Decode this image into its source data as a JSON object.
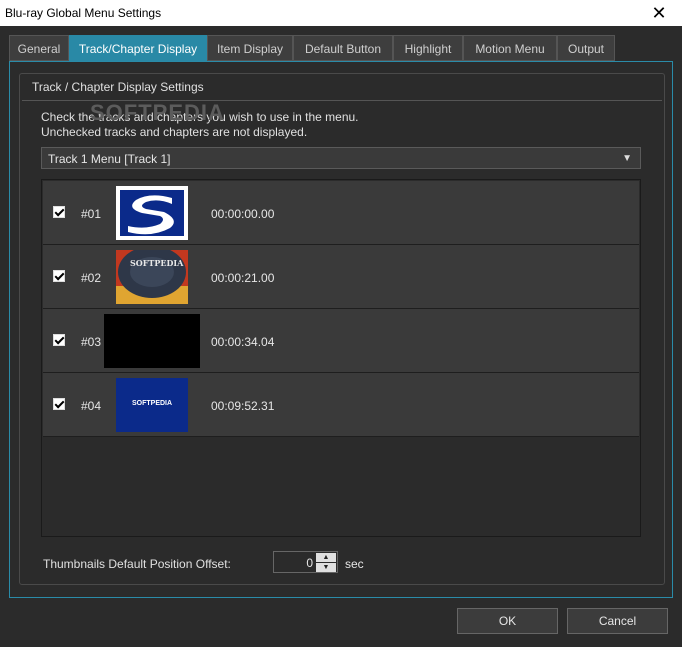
{
  "window": {
    "title": "Blu-ray Global Menu Settings"
  },
  "tabs": [
    {
      "label": "General"
    },
    {
      "label": "Track/Chapter Display",
      "active": true
    },
    {
      "label": "Item Display"
    },
    {
      "label": "Default Button"
    },
    {
      "label": "Highlight"
    },
    {
      "label": "Motion Menu"
    },
    {
      "label": "Output"
    }
  ],
  "group": {
    "title": "Track / Chapter Display Settings",
    "desc1": "Check the tracks and chapters you wish to use in the menu.",
    "desc2": "Unchecked tracks and chapters are not displayed."
  },
  "watermark": "SOFTPEDIA",
  "menu_select": {
    "value": "Track 1 Menu [Track 1]"
  },
  "rows": [
    {
      "number": "#01",
      "time": "00:00:00.00",
      "checked": true,
      "thumb": "softpedia-s-logo"
    },
    {
      "number": "#02",
      "time": "00:00:21.00",
      "checked": true,
      "thumb": "softpedia-disc",
      "thumb_text": "SOFTPEDIA"
    },
    {
      "number": "#03",
      "time": "00:00:34.04",
      "checked": true,
      "thumb": "black-frame"
    },
    {
      "number": "#04",
      "time": "00:09:52.31",
      "checked": true,
      "thumb": "softpedia-blue",
      "thumb_text": "SOFTPEDIA"
    }
  ],
  "offset": {
    "label": "Thumbnails Default Position Offset:",
    "value": "0",
    "unit": "sec"
  },
  "buttons": {
    "ok": "OK",
    "cancel": "Cancel"
  },
  "colors": {
    "accent": "#2989a6",
    "background": "#2b2b2b"
  }
}
